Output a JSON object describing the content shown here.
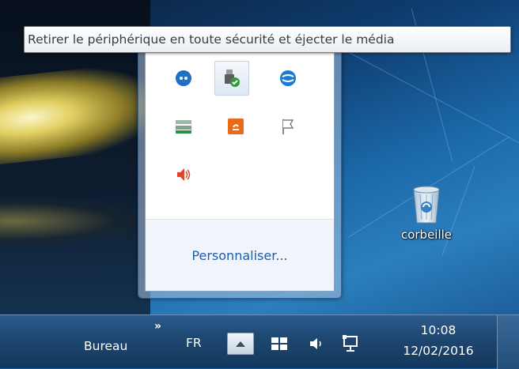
{
  "tooltip": {
    "text": "Retirer le périphérique en toute sécurité et éjecter le média"
  },
  "overflow_popup": {
    "icons": [
      "teamviewer-icon",
      "safely-remove-hardware-icon",
      "network-globe-icon",
      "battery-icon",
      "java-update-icon",
      "action-center-flag-icon",
      "speaker-icon"
    ],
    "customize_label": "Personnaliser..."
  },
  "desktop": {
    "recycle_bin_label": "corbeille"
  },
  "taskbar": {
    "toolbar_label": "Bureau",
    "toolbar_chevron": "»",
    "language": "FR",
    "time": "10:08",
    "date": "12/02/2016"
  }
}
